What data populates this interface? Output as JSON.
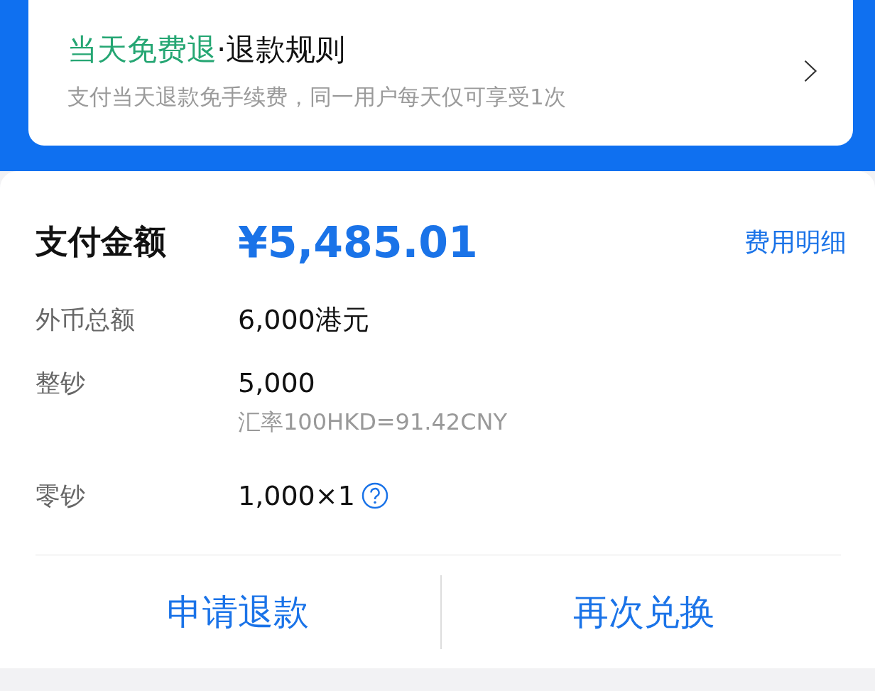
{
  "refund_card": {
    "title_highlight": "当天免费退",
    "title_rest": "·退款规则",
    "description": "支付当天退款免手续费，同一用户每天仅可享受1次"
  },
  "payment": {
    "label": "支付金额",
    "amount": "¥5,485.01",
    "details_link": "费用明细"
  },
  "rows": [
    {
      "label": "外币总额",
      "value": "6,000港元"
    },
    {
      "label": "整钞",
      "value": "5,000",
      "note": "汇率100HKD=91.42CNY"
    },
    {
      "label": "零钞",
      "value": "1,000×1",
      "help": true
    }
  ],
  "actions": [
    "申请退款",
    "再次兑换"
  ]
}
